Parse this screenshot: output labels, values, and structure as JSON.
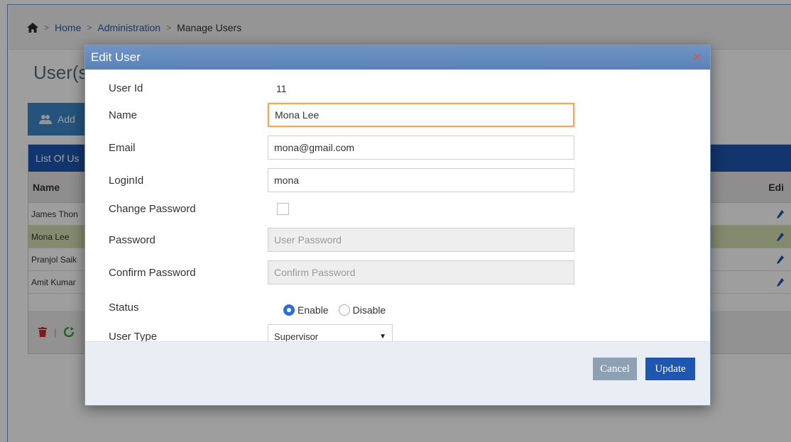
{
  "breadcrumb": {
    "home": "Home",
    "admin": "Administration",
    "current": "Manage Users"
  },
  "page": {
    "title": "User(s",
    "add_label": "Add"
  },
  "list": {
    "header": "List Of Us",
    "col_name": "Name",
    "col_edit": "Edi",
    "rows": [
      "James Thon",
      "Mona Lee",
      "Pranjol Saik",
      "Amit Kumar"
    ]
  },
  "modal": {
    "title": "Edit User",
    "fields": {
      "user_id_label": "User Id",
      "user_id_value": "11",
      "name_label": "Name",
      "name_value": "Mona Lee",
      "email_label": "Email",
      "email_value": "mona@gmail.com",
      "login_label": "LoginId",
      "login_value": "mona",
      "change_pw_label": "Change Password",
      "password_label": "Password",
      "password_placeholder": "User Password",
      "confirm_label": "Confirm Password",
      "confirm_placeholder": "Confirm Password",
      "status_label": "Status",
      "status_enable": "Enable",
      "status_disable": "Disable",
      "user_type_label": "User Type",
      "user_type_value": "Supervisor"
    },
    "buttons": {
      "cancel": "Cancel",
      "update": "Update"
    }
  },
  "colors": {
    "primary": "#1e56b0",
    "header": "#5b82b8",
    "focus": "#f0a860",
    "selected_row": "#d6dfb0"
  }
}
